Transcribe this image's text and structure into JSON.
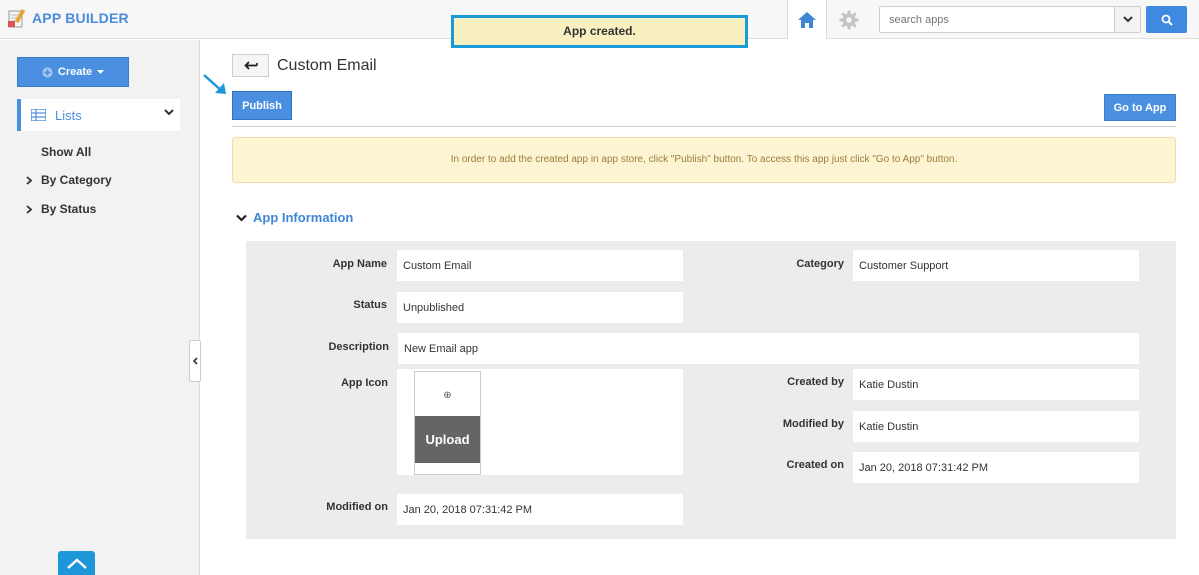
{
  "brand": {
    "title": "APP BUILDER"
  },
  "toast": {
    "message": "App created."
  },
  "search": {
    "placeholder": "search apps"
  },
  "sidebar": {
    "create_label": "Create",
    "lists_label": "Lists",
    "links": [
      "Show All",
      "By Category",
      "By Status"
    ]
  },
  "header": {
    "title": "Custom Email",
    "publish_label": "Publish",
    "goto_label": "Go to App"
  },
  "banner": {
    "text": "In order to add the created app in app store, click \"Publish\" button. To access this app just click \"Go to App\" button."
  },
  "section": {
    "title": "App Information"
  },
  "fields": {
    "app_name": {
      "label": "App Name",
      "value": "Custom Email"
    },
    "category": {
      "label": "Category",
      "value": "Customer Support"
    },
    "status": {
      "label": "Status",
      "value": "Unpublished"
    },
    "description": {
      "label": "Description",
      "value": "New Email app"
    },
    "app_icon": {
      "label": "App Icon",
      "upload_label": "Upload"
    },
    "created_by": {
      "label": "Created by",
      "value": "Katie Dustin"
    },
    "modified_by": {
      "label": "Modified by",
      "value": "Katie Dustin"
    },
    "created_on": {
      "label": "Created on",
      "value": "Jan 20, 2018 07:31:42 PM"
    },
    "modified_on": {
      "label": "Modified on",
      "value": "Jan 20, 2018 07:31:42 PM"
    }
  },
  "colors": {
    "accent": "#4a8fe0",
    "toast_border": "#1a9bd7",
    "banner_bg": "#fcf4d2"
  },
  "icons": [
    "app-builder-logo-icon",
    "home-icon",
    "gear-icon",
    "chevron-down-icon",
    "search-icon",
    "plus-circle-icon",
    "caret-down-icon",
    "list-icon",
    "chevron-right-icon",
    "back-arrow-icon",
    "pointer-arrow-icon",
    "collapse-left-icon",
    "scroll-top-icon"
  ]
}
